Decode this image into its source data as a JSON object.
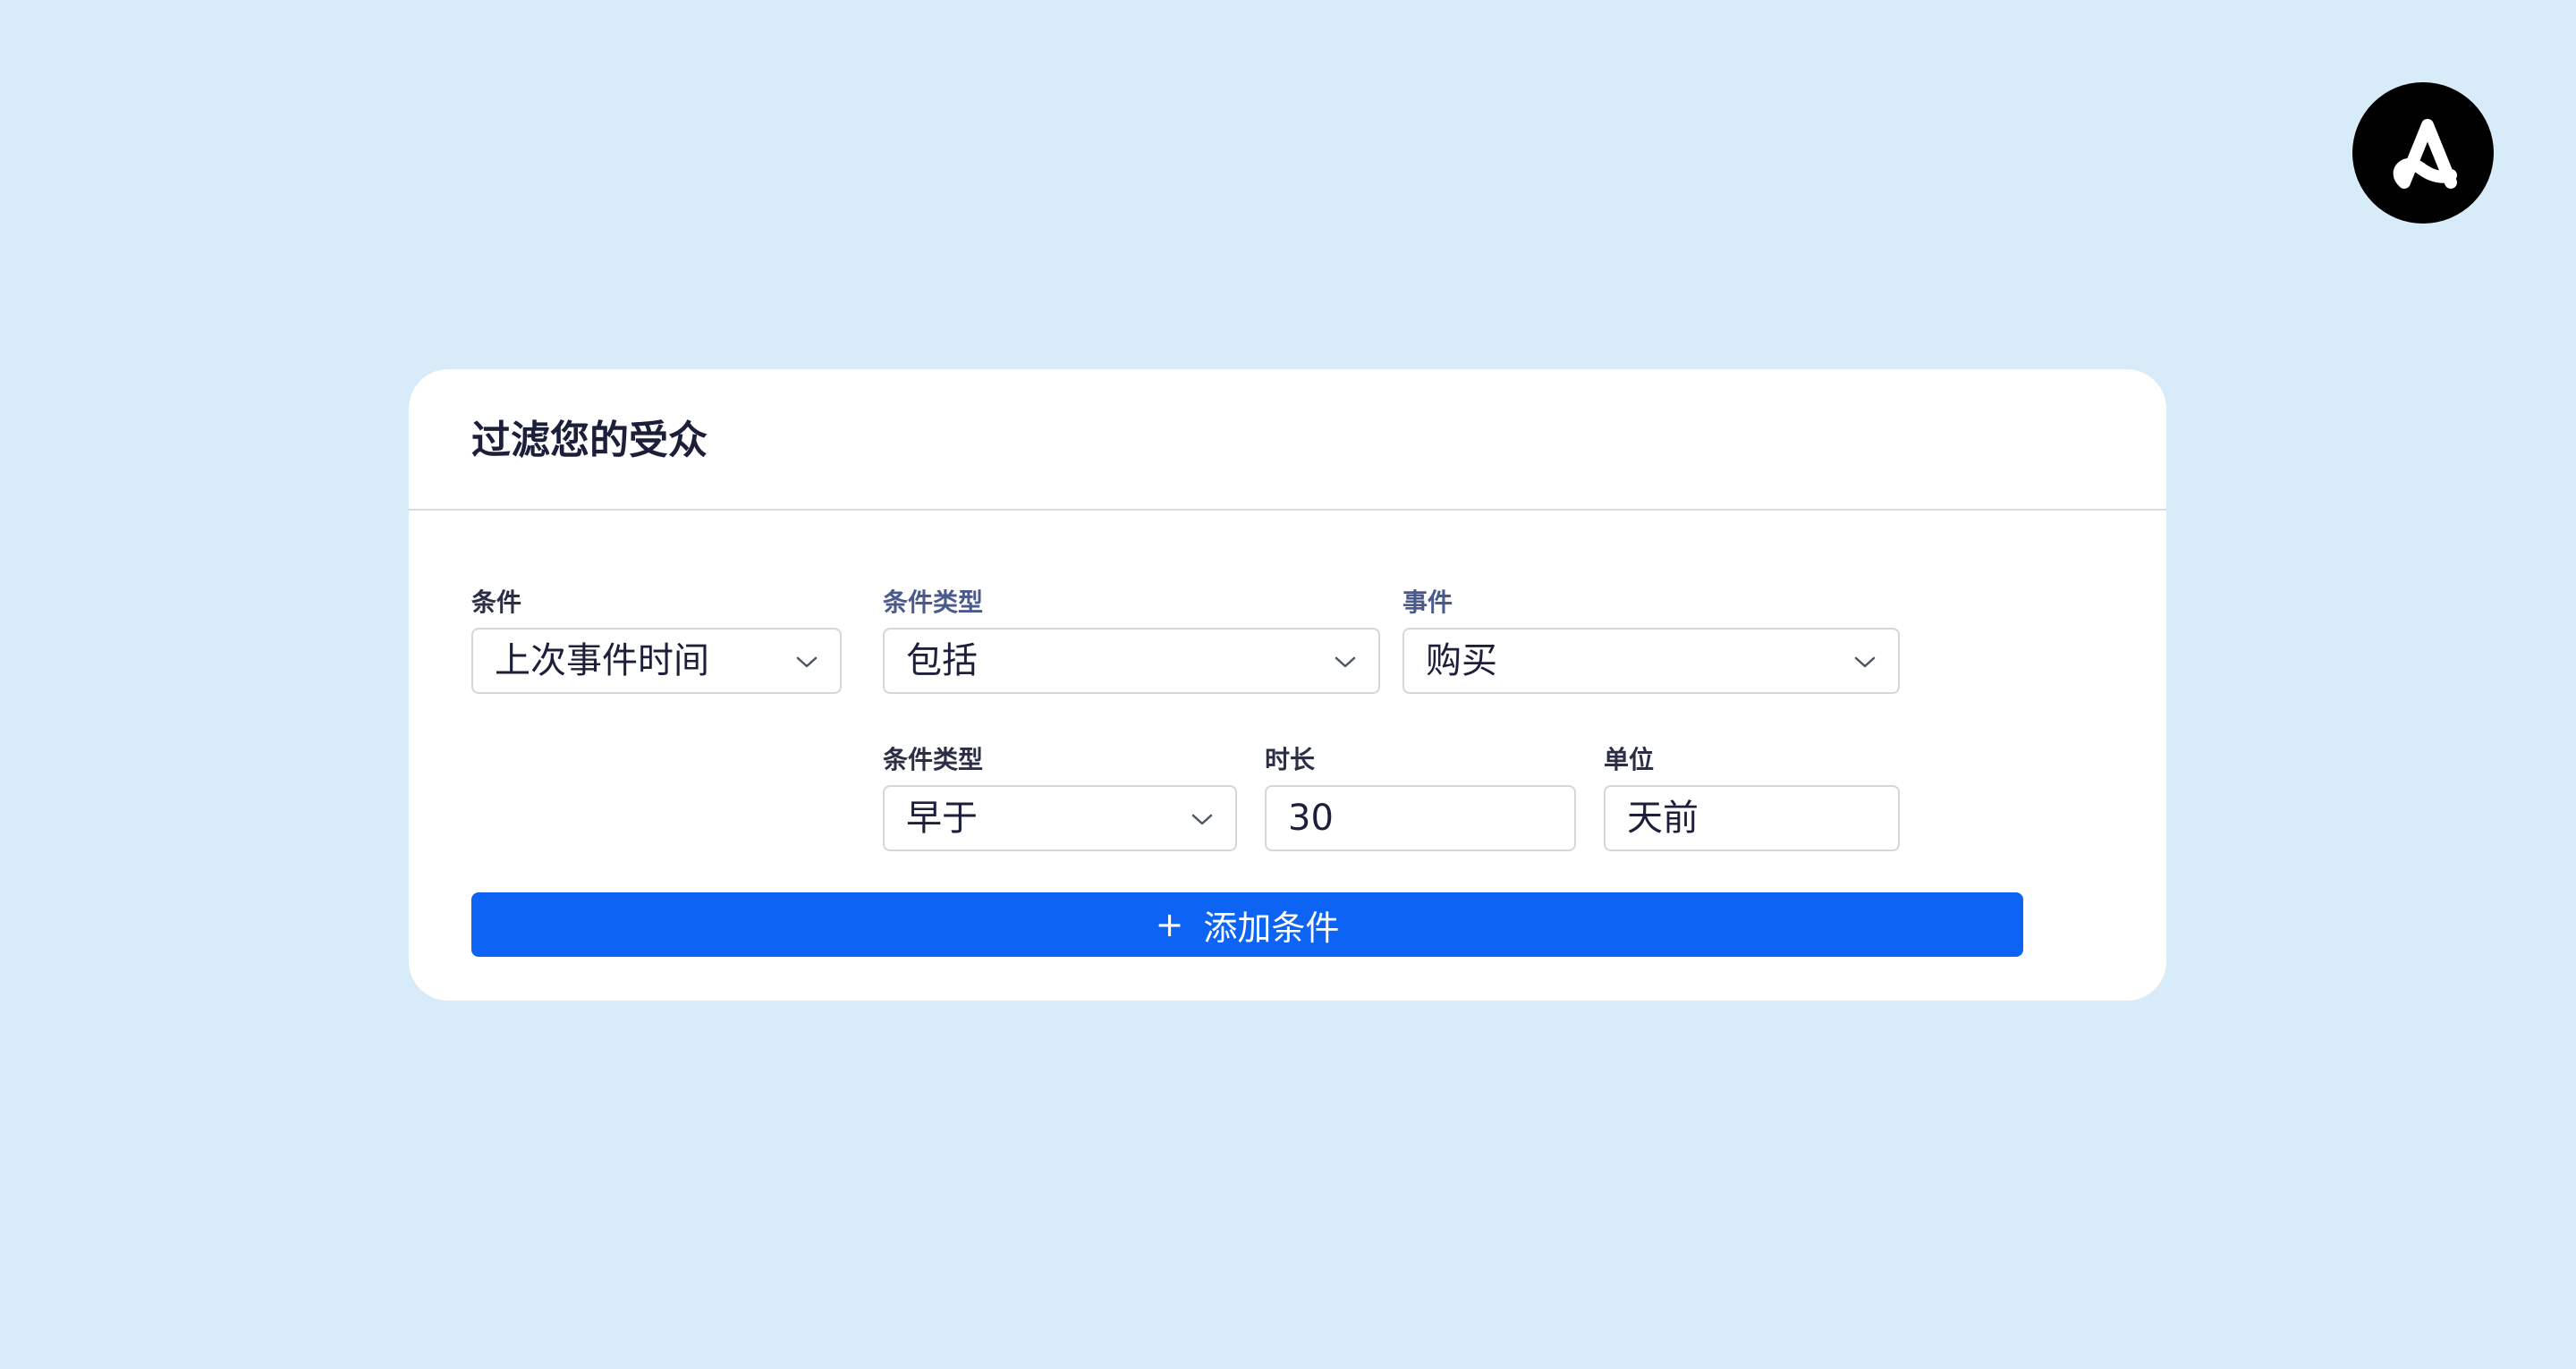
{
  "brand": {
    "logo_icon": "adobe-a-logo-icon",
    "logo_bg": "#000000"
  },
  "card": {
    "title": "过滤您的受众"
  },
  "row1": {
    "condition": {
      "label": "条件",
      "value": "上次事件时间"
    },
    "condition_type": {
      "label": "条件类型",
      "value": "包括"
    },
    "event": {
      "label": "事件",
      "value": "购买"
    }
  },
  "row2": {
    "condition_type": {
      "label": "条件类型",
      "value": "早于"
    },
    "duration": {
      "label": "时长",
      "value": "30"
    },
    "unit": {
      "label": "单位",
      "value": "天前"
    }
  },
  "add_button": {
    "plus": "+",
    "label": "添加条件"
  },
  "colors": {
    "page_bg": "#d8ebf9",
    "accent": "#0d63f3",
    "card_bg": "#ffffff"
  }
}
